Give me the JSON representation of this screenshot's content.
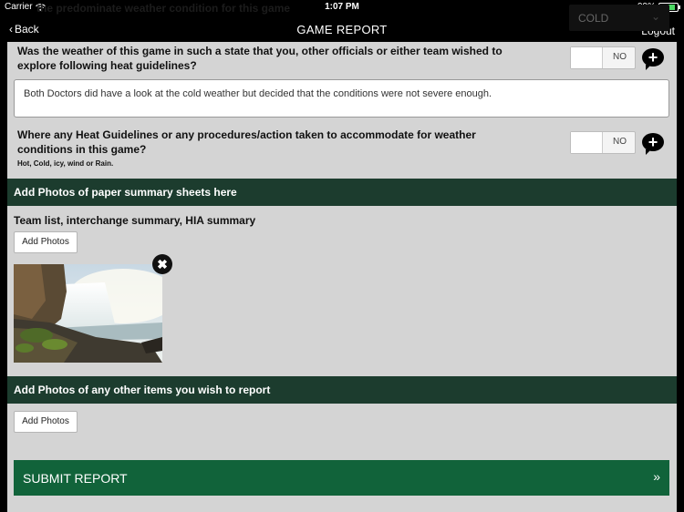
{
  "status": {
    "carrier": "Carrier",
    "time": "1:07 PM",
    "battery": "99%",
    "battery_fill": 0.99,
    "wifi_icon": "wifi-icon"
  },
  "ghost_question": "the predominate weather condition for this game",
  "weather_dropdown": {
    "value": "COLD"
  },
  "nav": {
    "back_label": "Back",
    "title": "GAME REPORT",
    "logout_label": "Logout"
  },
  "heat_question": {
    "text": "Was the weather of this game in such a state that you, other officials or either team wished to explore following heat guidelines?",
    "toggle": "NO"
  },
  "heat_notes": "Both Doctors did have a look at the cold weather but decided that the conditions were not severe enough.",
  "procedures_question": {
    "text": "Where any Heat Guidelines or any procedures/action taken to accommodate for weather conditions in this game?",
    "hint": "Hot, Cold, icy, wind or Rain.",
    "toggle": "NO"
  },
  "paper_section": {
    "title": "Add Photos of paper summary sheets here",
    "subtitle": "Team list, interchange summary, HIA summary",
    "add_label": "Add Photos"
  },
  "other_section": {
    "title": "Add Photos of any other items you wish to report",
    "add_label": "Add Photos"
  },
  "submit": {
    "label": "SUBMIT REPORT",
    "icon": "»"
  },
  "colors": {
    "band": "#1c3c2e",
    "submit": "#11633a",
    "page": "#d4d4d4"
  }
}
